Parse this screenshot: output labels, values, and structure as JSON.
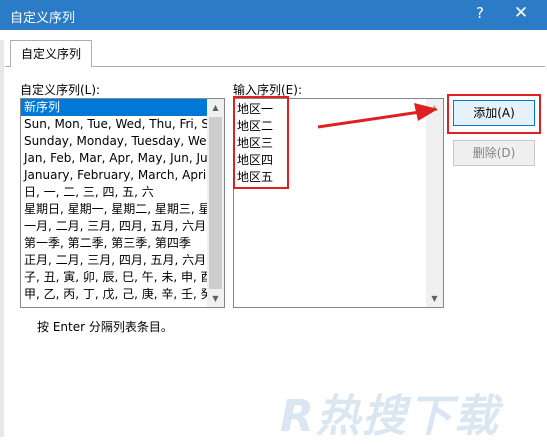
{
  "window": {
    "title": "自定义序列",
    "help_glyph": "?",
    "close_glyph": "✕"
  },
  "tab": {
    "label": "自定义序列"
  },
  "left_list": {
    "label": "自定义序列(L):",
    "items": [
      "新序列",
      "Sun, Mon, Tue, Wed, Thu, Fri, Sat",
      "Sunday, Monday, Tuesday, Wednesday",
      "Jan, Feb, Mar, Apr, May, Jun, Jul",
      "January, February, March, April",
      "日, 一, 二, 三, 四, 五, 六",
      "星期日, 星期一, 星期二, 星期三, 星期四",
      "一月, 二月, 三月, 四月, 五月, 六月",
      "第一季, 第二季, 第三季, 第四季",
      "正月, 二月, 三月, 四月, 五月, 六月",
      "子, 丑, 寅, 卯, 辰, 巳, 午, 未, 申, 酉",
      "甲, 乙, 丙, 丁, 戊, 己, 庚, 辛, 壬, 癸"
    ]
  },
  "right_list": {
    "label": "输入序列(E):",
    "entries": [
      "地区一",
      "地区二",
      "地区三",
      "地区四",
      "地区五"
    ]
  },
  "buttons": {
    "add_label": "添加(A)",
    "delete_label": "删除(D)"
  },
  "hint": "按 Enter 分隔列表条目。",
  "watermark": "R热搜下载",
  "colors": {
    "titlebar": "#2b7bc6",
    "highlight_red": "#e02020",
    "selection": "#0078d7"
  }
}
